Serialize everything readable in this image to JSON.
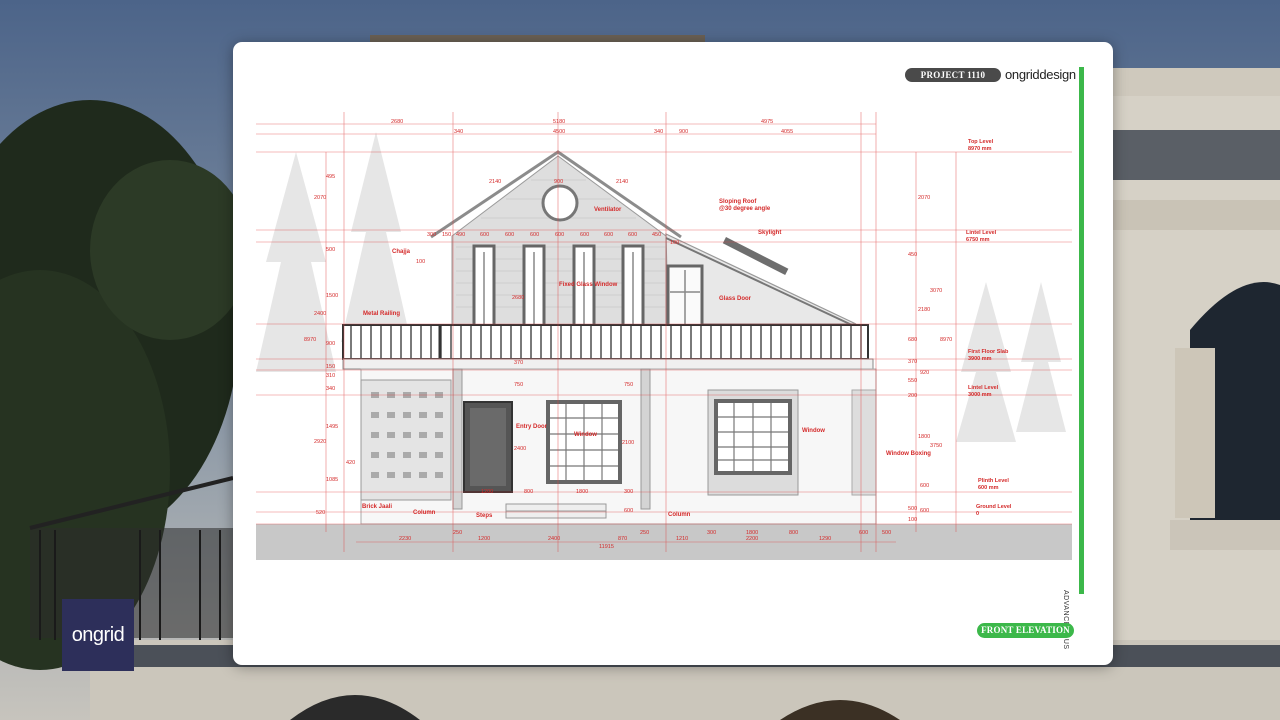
{
  "header": {
    "project_tag": "PROJECT 1110",
    "brand": "ongriddesign"
  },
  "footer": {
    "view_label": "FRONT ELEVATION",
    "side_text": "ADVANCE PLUS"
  },
  "badge": {
    "logo_text": "ongrid"
  },
  "drawing": {
    "labels": {
      "sloping_roof": [
        "Sloping Roof",
        "@30 degree angle"
      ],
      "ventilator": "Ventilator",
      "skylight": "Skylight",
      "chajja": "Chajja",
      "fixed_glass_window": "Fixed Glass Window",
      "glass_door": "Glass Door",
      "metal_railing": "Metal Railing",
      "entry_door": "Entry Door",
      "window": "Window",
      "window_boxing": "Window Boxing",
      "brick_jaali": "Brick Jaali",
      "column": "Column",
      "steps": "Steps"
    },
    "levels": [
      {
        "name": "Top Level",
        "value": "8970 mm"
      },
      {
        "name": "Lintel Level",
        "value": "6750 mm"
      },
      {
        "name": "First Floor Slab",
        "value": "3900 mm"
      },
      {
        "name": "Lintel Level",
        "value": "3000 mm"
      },
      {
        "name": "Plinth Level",
        "value": "600 mm"
      },
      {
        "name": "Ground Level",
        "value": "0"
      }
    ],
    "dims_top_row1": [
      "2680",
      "5180",
      "4975"
    ],
    "dims_top_row2": [
      "340",
      "4500",
      "340",
      "900",
      "4055"
    ],
    "dims_gable": [
      "2140",
      "900",
      "2140"
    ],
    "dims_gable_windows": [
      "300",
      "150",
      "490",
      "600",
      "600",
      "600",
      "600",
      "600",
      "600",
      "600",
      "450"
    ],
    "dims_left": [
      "495",
      "2070",
      "500",
      "1500",
      "2400",
      "900",
      "8970",
      "150",
      "310",
      "340",
      "1495",
      "2920",
      "420",
      "1085",
      "520"
    ],
    "dims_right": [
      "2070",
      "450",
      "3070",
      "2180",
      "680",
      "8970",
      "370",
      "920",
      "550",
      "200",
      "1800",
      "3750",
      "600",
      "500",
      "600",
      "100"
    ],
    "dims_inner": [
      "100",
      "100",
      "2680",
      "370",
      "750",
      "750",
      "2400",
      "2100",
      "1200",
      "800",
      "1800",
      "300",
      "600"
    ],
    "dims_bottom": [
      "2230",
      "250",
      "1200",
      "2400",
      "870",
      "250",
      "1210",
      "300",
      "1800",
      "2200",
      "800",
      "1290",
      "600",
      "500"
    ],
    "total_width": "11915"
  }
}
